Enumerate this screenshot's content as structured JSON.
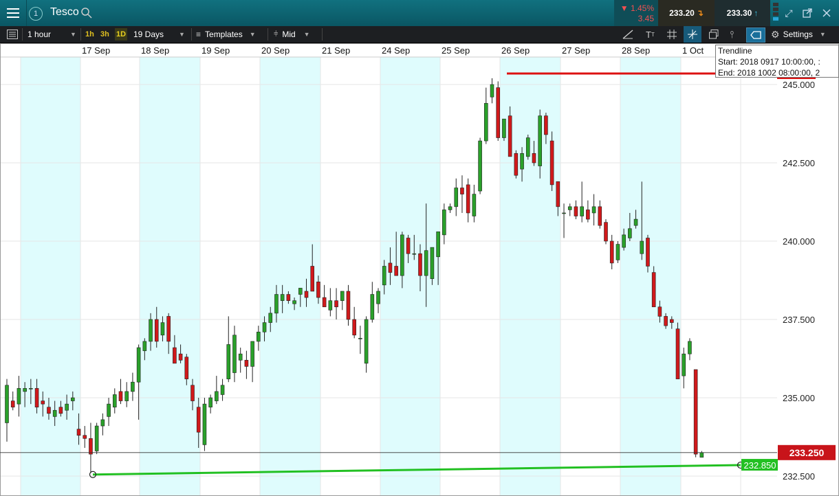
{
  "header": {
    "alert_badge": "1",
    "symbol": "Tesco",
    "change_pct": "▼ 1.45%",
    "change_abs": "3.45",
    "sell_price": "233.20",
    "buy_price": "233.30"
  },
  "toolbar": {
    "interval": "1 hour",
    "quick_1h": "1h",
    "quick_3h": "3h",
    "quick_1d": "1D",
    "range": "19 Days",
    "templates": "Templates",
    "price_type": "Mid",
    "settings": "Settings"
  },
  "chart_data": {
    "type": "candlestick",
    "symbol": "Tesco",
    "interval": "1 hour",
    "x_labels": [
      "17 Sep",
      "18 Sep",
      "19 Sep",
      "20 Sep",
      "21 Sep",
      "24 Sep",
      "25 Sep",
      "26 Sep",
      "27 Sep",
      "28 Sep",
      "1 Oct"
    ],
    "y_ticks": [
      "245.000",
      "242.500",
      "240.000",
      "237.500",
      "235.000",
      "232.500"
    ],
    "y_tick_values": [
      245.0,
      242.5,
      240.0,
      237.5,
      235.0,
      232.5
    ],
    "ylim": [
      232.0,
      246.25
    ],
    "grid": true,
    "current_price": "233.250",
    "candles": [
      {
        "o": 234.2,
        "h": 235.6,
        "l": 233.6,
        "c": 235.4
      },
      {
        "o": 234.9,
        "h": 235.2,
        "l": 234.6,
        "c": 234.7
      },
      {
        "o": 234.8,
        "h": 235.7,
        "l": 234.4,
        "c": 235.3
      },
      {
        "o": 235.2,
        "h": 235.5,
        "l": 234.7,
        "c": 235.3
      },
      {
        "o": 235.3,
        "h": 235.6,
        "l": 234.8,
        "c": 235.3
      },
      {
        "o": 235.3,
        "h": 235.6,
        "l": 234.5,
        "c": 234.7
      },
      {
        "o": 234.9,
        "h": 235.2,
        "l": 234.4,
        "c": 234.8
      },
      {
        "o": 234.7,
        "h": 235.0,
        "l": 234.3,
        "c": 234.5
      },
      {
        "o": 234.4,
        "h": 234.9,
        "l": 234.1,
        "c": 234.6
      },
      {
        "o": 234.7,
        "h": 234.9,
        "l": 234.4,
        "c": 234.5
      },
      {
        "o": 234.6,
        "h": 235.1,
        "l": 234.3,
        "c": 234.8
      },
      {
        "o": 234.9,
        "h": 235.2,
        "l": 234.6,
        "c": 235.0
      },
      {
        "o": 234.0,
        "h": 234.5,
        "l": 233.5,
        "c": 233.8
      },
      {
        "o": 233.8,
        "h": 234.1,
        "l": 233.4,
        "c": 233.7
      },
      {
        "o": 233.7,
        "h": 234.2,
        "l": 232.6,
        "c": 233.2
      },
      {
        "o": 233.3,
        "h": 234.2,
        "l": 233.2,
        "c": 234.1
      },
      {
        "o": 234.1,
        "h": 234.5,
        "l": 233.8,
        "c": 234.3
      },
      {
        "o": 234.4,
        "h": 235.0,
        "l": 234.1,
        "c": 234.8
      },
      {
        "o": 234.7,
        "h": 235.3,
        "l": 234.5,
        "c": 235.1
      },
      {
        "o": 235.2,
        "h": 235.6,
        "l": 234.8,
        "c": 234.9
      },
      {
        "o": 234.9,
        "h": 235.5,
        "l": 234.7,
        "c": 235.2
      },
      {
        "o": 235.2,
        "h": 235.8,
        "l": 234.9,
        "c": 235.5
      },
      {
        "o": 235.5,
        "h": 236.7,
        "l": 234.3,
        "c": 236.6
      },
      {
        "o": 236.5,
        "h": 236.9,
        "l": 236.2,
        "c": 236.8
      },
      {
        "o": 236.8,
        "h": 237.7,
        "l": 236.5,
        "c": 237.5
      },
      {
        "o": 237.5,
        "h": 237.9,
        "l": 236.6,
        "c": 236.8
      },
      {
        "o": 237.0,
        "h": 237.6,
        "l": 236.8,
        "c": 237.4
      },
      {
        "o": 237.6,
        "h": 237.7,
        "l": 236.4,
        "c": 236.8
      },
      {
        "o": 236.6,
        "h": 237.0,
        "l": 236.1,
        "c": 236.1
      },
      {
        "o": 236.4,
        "h": 236.7,
        "l": 236.1,
        "c": 236.2
      },
      {
        "o": 236.3,
        "h": 236.4,
        "l": 235.4,
        "c": 235.6
      },
      {
        "o": 235.4,
        "h": 235.6,
        "l": 234.6,
        "c": 234.9
      },
      {
        "o": 234.7,
        "h": 235.0,
        "l": 233.4,
        "c": 233.9
      },
      {
        "o": 233.5,
        "h": 235.0,
        "l": 233.3,
        "c": 234.8
      },
      {
        "o": 234.7,
        "h": 235.1,
        "l": 234.5,
        "c": 235.0
      },
      {
        "o": 234.9,
        "h": 235.7,
        "l": 234.8,
        "c": 235.2
      },
      {
        "o": 235.1,
        "h": 235.6,
        "l": 234.9,
        "c": 235.4
      },
      {
        "o": 235.6,
        "h": 237.6,
        "l": 235.5,
        "c": 236.7
      },
      {
        "o": 235.8,
        "h": 237.3,
        "l": 235.5,
        "c": 237.0
      },
      {
        "o": 236.2,
        "h": 236.6,
        "l": 235.8,
        "c": 236.4
      },
      {
        "o": 236.2,
        "h": 236.5,
        "l": 235.6,
        "c": 236.0
      },
      {
        "o": 236.0,
        "h": 236.8,
        "l": 235.5,
        "c": 236.8
      },
      {
        "o": 236.8,
        "h": 237.3,
        "l": 236.5,
        "c": 237.1
      },
      {
        "o": 237.1,
        "h": 237.6,
        "l": 236.8,
        "c": 237.4
      },
      {
        "o": 237.4,
        "h": 237.9,
        "l": 237.1,
        "c": 237.7
      },
      {
        "o": 237.7,
        "h": 238.6,
        "l": 237.4,
        "c": 238.3
      },
      {
        "o": 238.1,
        "h": 238.6,
        "l": 237.7,
        "c": 238.3
      },
      {
        "o": 238.3,
        "h": 238.4,
        "l": 238.0,
        "c": 238.1
      },
      {
        "o": 238.0,
        "h": 238.2,
        "l": 237.8,
        "c": 238.1
      },
      {
        "o": 238.3,
        "h": 238.5,
        "l": 237.9,
        "c": 238.5
      },
      {
        "o": 238.4,
        "h": 238.8,
        "l": 237.9,
        "c": 238.2
      },
      {
        "o": 239.2,
        "h": 239.9,
        "l": 238.4,
        "c": 238.4
      },
      {
        "o": 238.7,
        "h": 238.9,
        "l": 238.0,
        "c": 238.2
      },
      {
        "o": 238.2,
        "h": 238.6,
        "l": 237.9,
        "c": 237.9
      },
      {
        "o": 237.8,
        "h": 238.5,
        "l": 237.6,
        "c": 238.1
      },
      {
        "o": 238.1,
        "h": 238.5,
        "l": 237.5,
        "c": 237.9
      },
      {
        "o": 238.1,
        "h": 238.4,
        "l": 237.8,
        "c": 238.4
      },
      {
        "o": 238.4,
        "h": 238.6,
        "l": 237.3,
        "c": 237.5
      },
      {
        "o": 237.5,
        "h": 237.9,
        "l": 236.9,
        "c": 237.0
      },
      {
        "o": 236.9,
        "h": 237.3,
        "l": 236.4,
        "c": 236.9
      },
      {
        "o": 236.1,
        "h": 237.6,
        "l": 235.8,
        "c": 237.5
      },
      {
        "o": 237.5,
        "h": 238.7,
        "l": 237.4,
        "c": 238.3
      },
      {
        "o": 238.0,
        "h": 238.5,
        "l": 237.7,
        "c": 238.4
      },
      {
        "o": 238.6,
        "h": 239.4,
        "l": 238.3,
        "c": 239.2
      },
      {
        "o": 239.3,
        "h": 239.8,
        "l": 238.6,
        "c": 239.0
      },
      {
        "o": 239.2,
        "h": 240.3,
        "l": 238.9,
        "c": 238.9
      },
      {
        "o": 238.9,
        "h": 240.3,
        "l": 238.5,
        "c": 240.2
      },
      {
        "o": 240.1,
        "h": 240.2,
        "l": 239.3,
        "c": 239.6
      },
      {
        "o": 239.6,
        "h": 240.2,
        "l": 239.4,
        "c": 239.6
      },
      {
        "o": 239.6,
        "h": 239.9,
        "l": 238.4,
        "c": 238.9
      },
      {
        "o": 238.9,
        "h": 241.2,
        "l": 237.9,
        "c": 239.7
      },
      {
        "o": 238.8,
        "h": 239.8,
        "l": 238.6,
        "c": 239.8
      },
      {
        "o": 239.5,
        "h": 240.3,
        "l": 238.6,
        "c": 240.3
      },
      {
        "o": 240.2,
        "h": 241.2,
        "l": 239.9,
        "c": 241.0
      },
      {
        "o": 241.0,
        "h": 241.2,
        "l": 240.9,
        "c": 241.1
      },
      {
        "o": 241.1,
        "h": 242.0,
        "l": 240.8,
        "c": 241.7
      },
      {
        "o": 241.7,
        "h": 242.1,
        "l": 240.9,
        "c": 241.5
      },
      {
        "o": 241.8,
        "h": 242.0,
        "l": 240.6,
        "c": 240.9
      },
      {
        "o": 240.8,
        "h": 241.8,
        "l": 240.6,
        "c": 241.5
      },
      {
        "o": 241.6,
        "h": 243.3,
        "l": 241.5,
        "c": 243.2
      },
      {
        "o": 243.2,
        "h": 244.9,
        "l": 243.1,
        "c": 244.4
      },
      {
        "o": 244.6,
        "h": 245.2,
        "l": 244.4,
        "c": 245.0
      },
      {
        "o": 244.9,
        "h": 245.1,
        "l": 243.2,
        "c": 243.3
      },
      {
        "o": 243.3,
        "h": 243.9,
        "l": 243.2,
        "c": 243.9
      },
      {
        "o": 244.0,
        "h": 244.3,
        "l": 242.7,
        "c": 242.7
      },
      {
        "o": 242.8,
        "h": 242.9,
        "l": 242.0,
        "c": 242.1
      },
      {
        "o": 242.3,
        "h": 243.0,
        "l": 241.9,
        "c": 242.8
      },
      {
        "o": 242.7,
        "h": 243.4,
        "l": 242.6,
        "c": 243.3
      },
      {
        "o": 242.8,
        "h": 243.2,
        "l": 242.4,
        "c": 242.5
      },
      {
        "o": 242.4,
        "h": 244.2,
        "l": 242.0,
        "c": 244.0
      },
      {
        "o": 244.0,
        "h": 244.1,
        "l": 243.1,
        "c": 243.4
      },
      {
        "o": 243.2,
        "h": 243.5,
        "l": 241.6,
        "c": 241.8
      },
      {
        "o": 241.9,
        "h": 241.9,
        "l": 240.8,
        "c": 241.1
      },
      {
        "o": 240.9,
        "h": 241.2,
        "l": 240.1,
        "c": 240.9
      },
      {
        "o": 241.0,
        "h": 241.2,
        "l": 240.8,
        "c": 241.1
      },
      {
        "o": 241.1,
        "h": 241.3,
        "l": 240.7,
        "c": 240.8
      },
      {
        "o": 240.8,
        "h": 241.9,
        "l": 240.6,
        "c": 241.1
      },
      {
        "o": 241.0,
        "h": 241.3,
        "l": 240.6,
        "c": 240.7
      },
      {
        "o": 240.9,
        "h": 241.5,
        "l": 240.5,
        "c": 241.1
      },
      {
        "o": 241.1,
        "h": 241.3,
        "l": 240.4,
        "c": 240.5
      },
      {
        "o": 240.6,
        "h": 240.7,
        "l": 239.9,
        "c": 240.0
      },
      {
        "o": 240.0,
        "h": 240.2,
        "l": 239.1,
        "c": 239.3
      },
      {
        "o": 239.4,
        "h": 240.0,
        "l": 239.3,
        "c": 239.9
      },
      {
        "o": 239.8,
        "h": 240.4,
        "l": 239.7,
        "c": 240.2
      },
      {
        "o": 240.1,
        "h": 240.9,
        "l": 240.0,
        "c": 240.4
      },
      {
        "o": 240.5,
        "h": 241.0,
        "l": 240.4,
        "c": 240.7
      },
      {
        "o": 239.6,
        "h": 241.9,
        "l": 239.4,
        "c": 240.0
      },
      {
        "o": 240.1,
        "h": 240.2,
        "l": 239.0,
        "c": 239.2
      },
      {
        "o": 239.0,
        "h": 239.2,
        "l": 237.9,
        "c": 237.9
      },
      {
        "o": 237.9,
        "h": 238.1,
        "l": 237.4,
        "c": 237.6
      },
      {
        "o": 237.6,
        "h": 237.7,
        "l": 237.2,
        "c": 237.3
      },
      {
        "o": 237.5,
        "h": 237.6,
        "l": 237.2,
        "c": 237.4
      },
      {
        "o": 237.2,
        "h": 237.4,
        "l": 235.6,
        "c": 235.6
      },
      {
        "o": 235.7,
        "h": 236.6,
        "l": 235.3,
        "c": 236.4
      },
      {
        "o": 236.4,
        "h": 236.9,
        "l": 236.2,
        "c": 236.8
      },
      {
        "o": 235.9,
        "h": 235.9,
        "l": 233.1,
        "c": 233.2
      },
      {
        "o": 233.1,
        "h": 233.3,
        "l": 233.1,
        "c": 233.25
      }
    ]
  },
  "lines": {
    "resistance_label": "245.350",
    "support_label": "232.850"
  },
  "tooltip": {
    "title": "Trendline",
    "start": "Start: 2018 0917 10:00:00, :",
    "end": "End: 2018 1002 08:00:00, 2"
  },
  "colors": {
    "up": "#2aa02a",
    "down": "#d0191b",
    "band": "#dffcfd",
    "resistance": "#dd1111",
    "support": "#22c022",
    "price_label": "#c8141a",
    "header": "#0b6270"
  }
}
